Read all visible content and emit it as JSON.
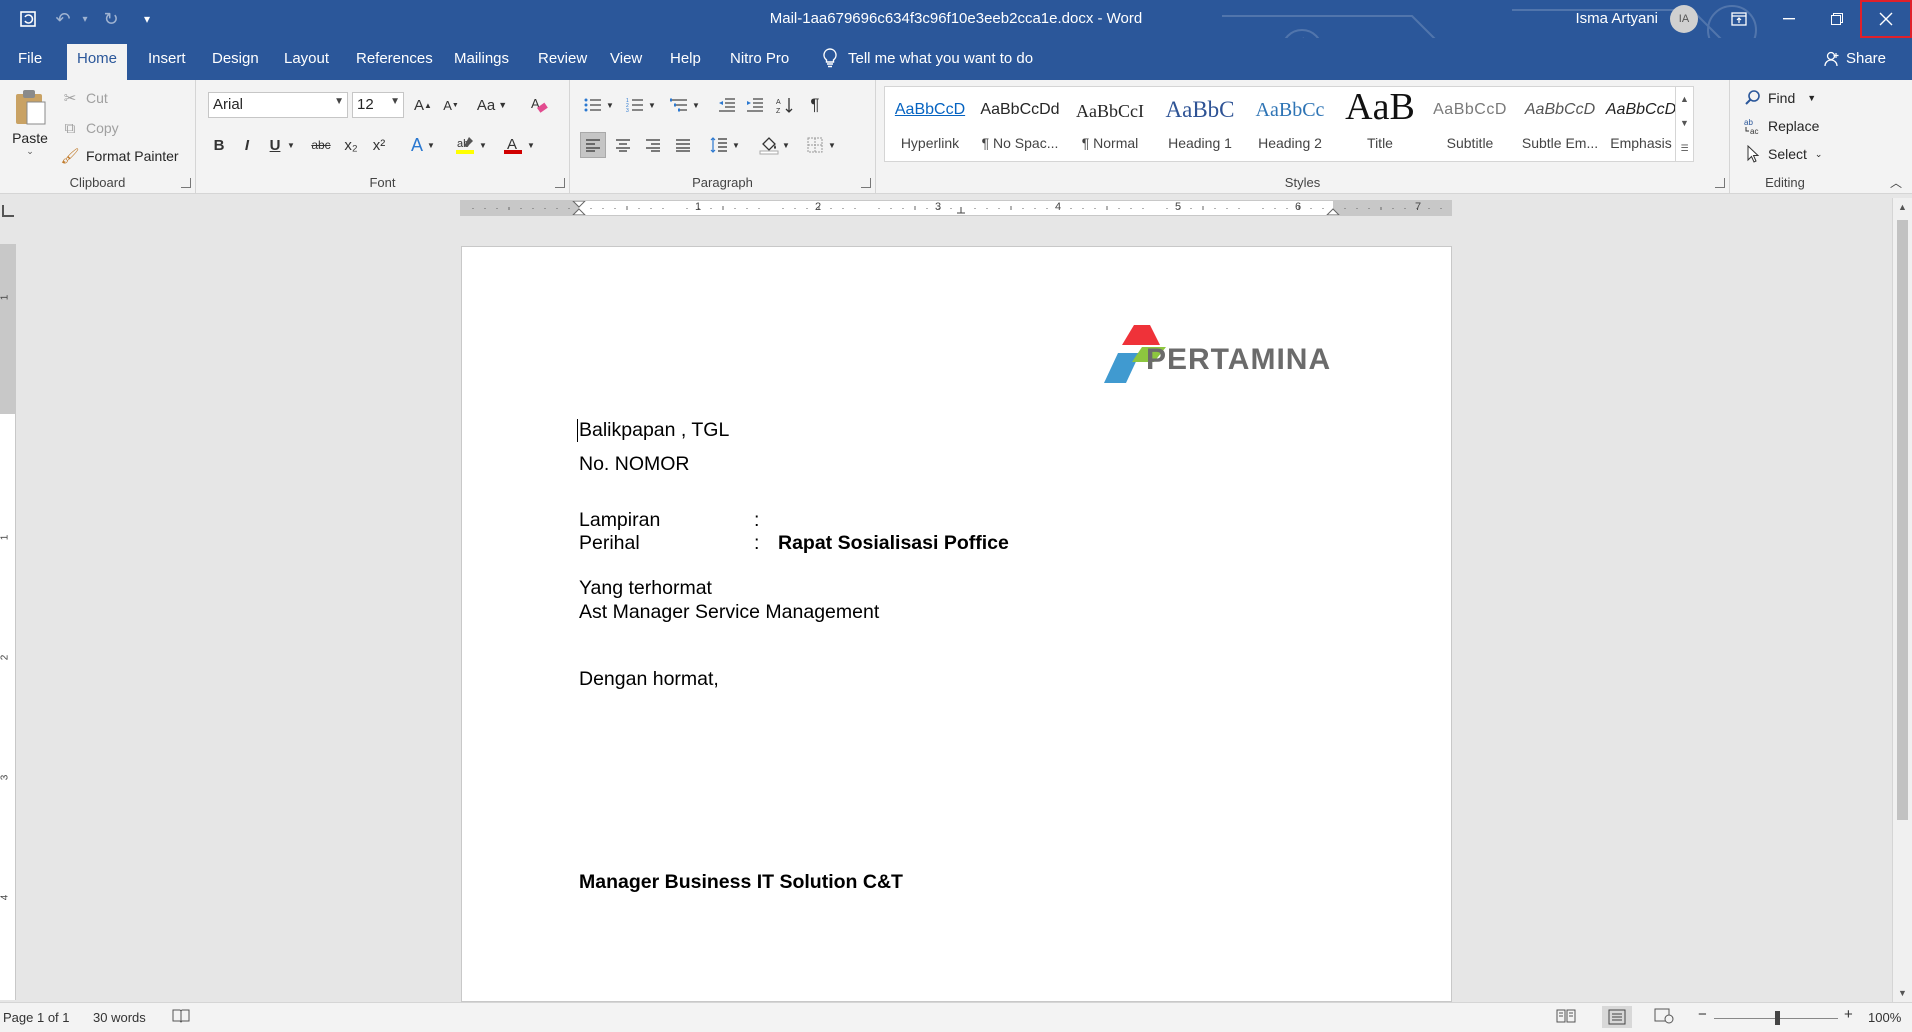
{
  "titlebar": {
    "doc_title": "Mail-1aa679696c634f3c96f10e3eeb2cca1e.docx  -  Word",
    "user_name": "Isma Artyani",
    "user_initials": "IA",
    "qat_customize": "▾"
  },
  "tabs": [
    "File",
    "Home",
    "Insert",
    "Design",
    "Layout",
    "References",
    "Mailings",
    "Review",
    "View",
    "Help",
    "Nitro Pro"
  ],
  "tellme": "Tell me what you want to do",
  "share": "Share",
  "clipboard": {
    "paste": "Paste",
    "cut": "Cut",
    "copy": "Copy",
    "format_painter": "Format Painter",
    "label": "Clipboard"
  },
  "font": {
    "name": "Arial",
    "size": "12",
    "label": "Font",
    "grow": "A",
    "shrink": "A",
    "case": "Aa",
    "bold": "B",
    "italic": "I",
    "underline": "U",
    "strike": "abc",
    "subscript": "x₂",
    "superscript": "x²",
    "color_accent": "#d83b01",
    "highlight_accent": "#ffff00"
  },
  "paragraph": {
    "label": "Paragraph",
    "pilcrow": "¶"
  },
  "styles": {
    "label": "Styles",
    "items": [
      {
        "sample": "AaBbCcD",
        "name": "Hyperlink"
      },
      {
        "sample": "AaBbCcDd",
        "name": "¶ No Spac..."
      },
      {
        "sample": "AaBbCcI",
        "name": "¶ Normal"
      },
      {
        "sample": "AaBbC",
        "name": "Heading 1"
      },
      {
        "sample": "AaBbCc",
        "name": "Heading 2"
      },
      {
        "sample": "AaB",
        "name": "Title"
      },
      {
        "sample": "AaBbCcD",
        "name": "Subtitle"
      },
      {
        "sample": "AaBbCcD",
        "name": "Subtle Em..."
      },
      {
        "sample": "AaBbCcD",
        "name": "Emphasis"
      }
    ]
  },
  "editing": {
    "label": "Editing",
    "find": "Find",
    "replace": "Replace",
    "select": "Select"
  },
  "ruler": {
    "h_numbers": [
      "1",
      "2",
      "3",
      "4",
      "5",
      "6",
      "7"
    ],
    "v_numbers": [
      "1",
      "1",
      "2",
      "3",
      "4"
    ]
  },
  "document": {
    "logo_text": "PERTAMINA",
    "line_place_date": "Balikpapan ,  TGL",
    "line_number": "No.  NOMOR",
    "lampiran_label": "Lampiran",
    "lampiran_colon": ":",
    "perihal_label": "Perihal",
    "perihal_colon": ":",
    "perihal_value": "Rapat Sosialisasi Poffice",
    "recipient_1": "Yang terhormat",
    "recipient_2": "Ast Manager Service Management",
    "greeting": "Dengan hormat,",
    "signature": "Manager Business IT Solution C&T"
  },
  "status": {
    "page": "Page 1 of 1",
    "words": "30 words",
    "zoom": "100%",
    "zoom_minus": "−",
    "zoom_plus": "+"
  }
}
